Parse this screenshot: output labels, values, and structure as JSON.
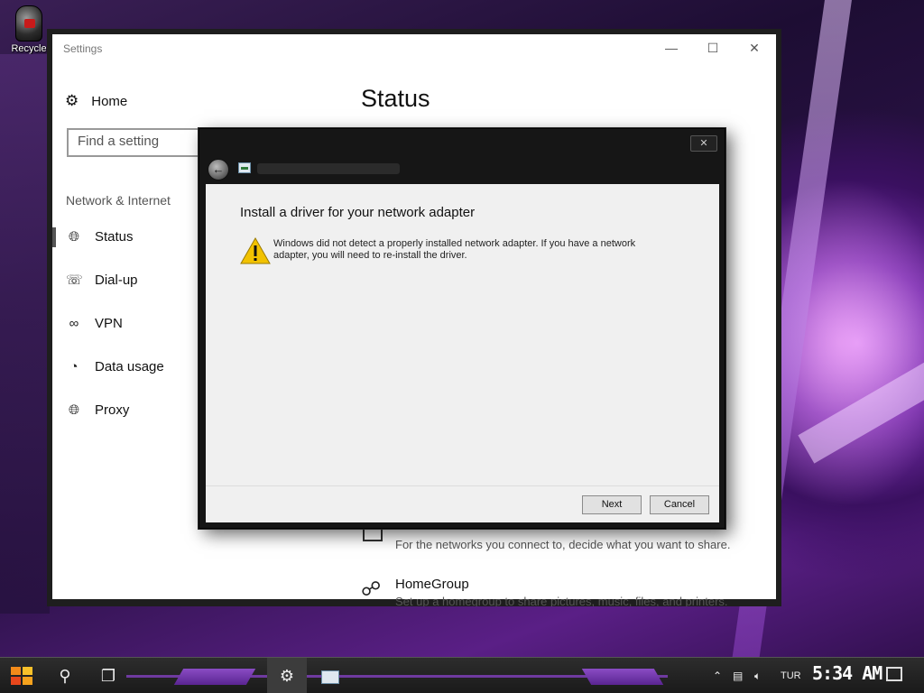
{
  "desktop": {
    "recycle_label": "Recycle"
  },
  "settings": {
    "window_title": "Settings",
    "home_label": "Home",
    "search_placeholder": "Find a setting",
    "section_title": "Network & Internet",
    "page_title": "Status",
    "nav": [
      {
        "label": "Status",
        "icon": "globe-icon"
      },
      {
        "label": "Dial-up",
        "icon": "dialup-icon"
      },
      {
        "label": "VPN",
        "icon": "vpn-icon"
      },
      {
        "label": "Data usage",
        "icon": "pie-chart-icon"
      },
      {
        "label": "Proxy",
        "icon": "globe-icon"
      }
    ],
    "sharing_desc": "For the networks you connect to, decide what you want to share.",
    "homegroup_title": "HomeGroup",
    "homegroup_desc": "Set up a homegroup to share pictures, music, files, and printers."
  },
  "dialog": {
    "heading": "Install a driver for your network adapter",
    "message": "Windows did not detect a properly installed network adapter. If you have a network adapter, you will need to re-install the driver.",
    "next_label": "Next",
    "cancel_label": "Cancel",
    "close_glyph": "✕"
  },
  "taskbar": {
    "language": "TUR",
    "clock": "5:34 AM"
  }
}
